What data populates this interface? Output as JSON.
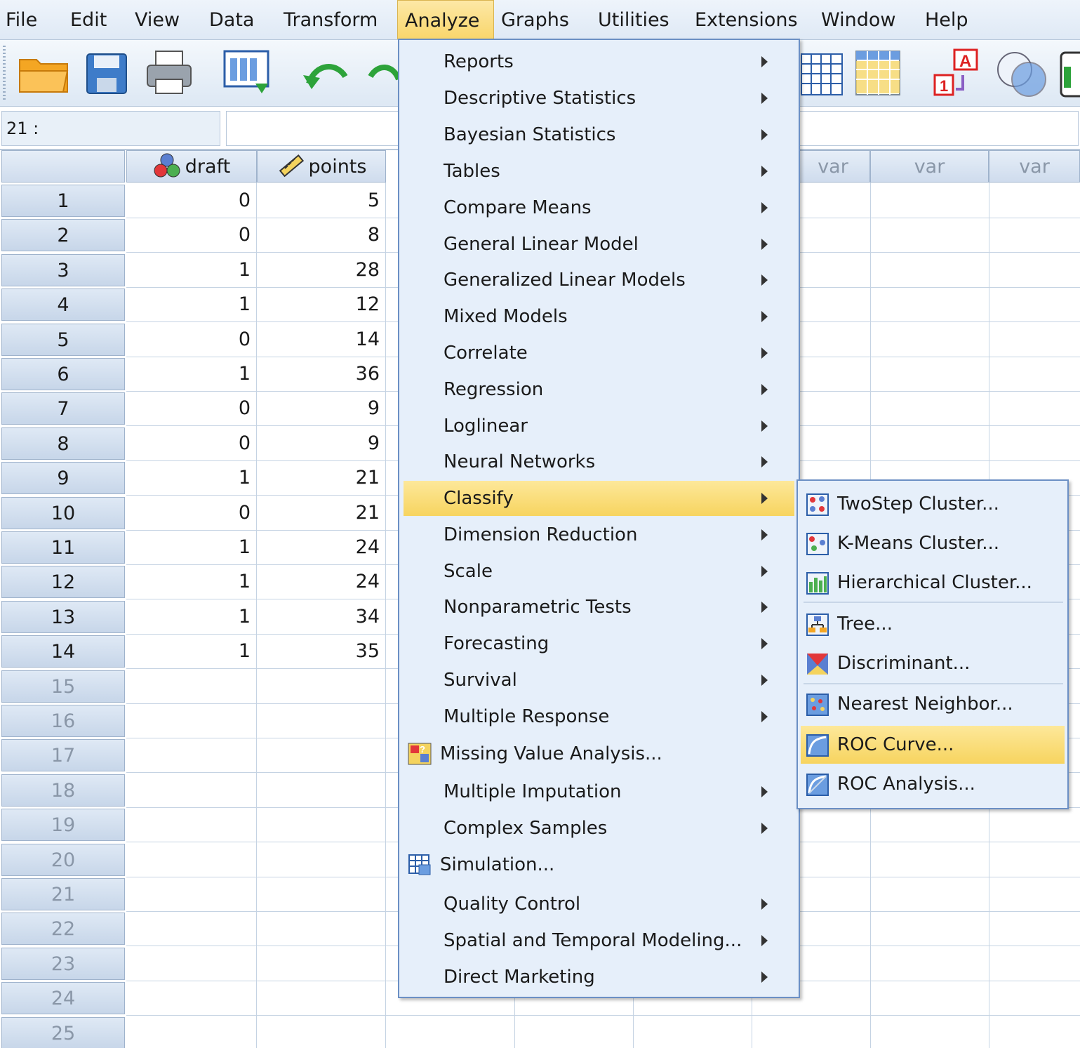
{
  "menubar": [
    "File",
    "Edit",
    "View",
    "Data",
    "Transform",
    "Analyze",
    "Graphs",
    "Utilities",
    "Extensions",
    "Window",
    "Help"
  ],
  "active_menu": "Analyze",
  "toolbar": {
    "icons": [
      "open-folder-icon",
      "save-icon",
      "print-icon",
      "recall-dialog-icon",
      "undo-icon",
      "redo-icon",
      "goto-case-icon",
      "goto-variable-icon",
      "value-labels-icon",
      "use-sets-icon"
    ]
  },
  "cell_editor": {
    "ref": "21 :",
    "value": ""
  },
  "grid": {
    "columns": [
      {
        "name": "draft",
        "type": "nominal"
      },
      {
        "name": "points",
        "type": "scale"
      },
      {
        "name": "var"
      },
      {
        "name": "var"
      },
      {
        "name": "var"
      }
    ],
    "rows": [
      "1",
      "2",
      "3",
      "4",
      "5",
      "6",
      "7",
      "8",
      "9",
      "10",
      "11",
      "12",
      "13",
      "14",
      "15",
      "16",
      "17",
      "18",
      "19",
      "20",
      "21",
      "22",
      "23",
      "24",
      "25"
    ],
    "data": [
      [
        "0",
        "5"
      ],
      [
        "0",
        "8"
      ],
      [
        "1",
        "28"
      ],
      [
        "1",
        "12"
      ],
      [
        "0",
        "14"
      ],
      [
        "1",
        "36"
      ],
      [
        "0",
        "9"
      ],
      [
        "0",
        "9"
      ],
      [
        "1",
        "21"
      ],
      [
        "0",
        "21"
      ],
      [
        "1",
        "24"
      ],
      [
        "1",
        "24"
      ],
      [
        "1",
        "34"
      ],
      [
        "1",
        "35"
      ]
    ]
  },
  "analyze_menu": [
    {
      "label": "Reports",
      "submenu": true
    },
    {
      "label": "Descriptive Statistics",
      "submenu": true
    },
    {
      "label": "Bayesian Statistics",
      "submenu": true
    },
    {
      "label": "Tables",
      "submenu": true
    },
    {
      "label": "Compare Means",
      "submenu": true
    },
    {
      "label": "General Linear Model",
      "submenu": true
    },
    {
      "label": "Generalized Linear Models",
      "submenu": true
    },
    {
      "label": "Mixed Models",
      "submenu": true
    },
    {
      "label": "Correlate",
      "submenu": true
    },
    {
      "label": "Regression",
      "submenu": true
    },
    {
      "label": "Loglinear",
      "submenu": true
    },
    {
      "label": "Neural Networks",
      "submenu": true
    },
    {
      "label": "Classify",
      "submenu": true,
      "highlighted": true
    },
    {
      "label": "Dimension Reduction",
      "submenu": true
    },
    {
      "label": "Scale",
      "submenu": true
    },
    {
      "label": "Nonparametric Tests",
      "submenu": true
    },
    {
      "label": "Forecasting",
      "submenu": true
    },
    {
      "label": "Survival",
      "submenu": true
    },
    {
      "label": "Multiple Response",
      "submenu": true
    },
    {
      "label": "Missing Value Analysis...",
      "submenu": false,
      "icon": "missing-value-icon"
    },
    {
      "label": "Multiple Imputation",
      "submenu": true
    },
    {
      "label": "Complex Samples",
      "submenu": true
    },
    {
      "label": "Simulation...",
      "submenu": false,
      "icon": "simulation-icon"
    },
    {
      "label": "Quality Control",
      "submenu": true
    },
    {
      "label": "Spatial and Temporal Modeling...",
      "submenu": true
    },
    {
      "label": "Direct Marketing",
      "submenu": true
    }
  ],
  "classify_submenu": [
    {
      "label": "TwoStep Cluster...",
      "icon": "twostep-cluster-icon"
    },
    {
      "label": "K-Means Cluster...",
      "icon": "kmeans-cluster-icon"
    },
    {
      "label": "Hierarchical Cluster...",
      "icon": "hierarchical-cluster-icon"
    },
    {
      "label": "Tree...",
      "icon": "tree-icon"
    },
    {
      "label": "Discriminant...",
      "icon": "discriminant-icon"
    },
    {
      "label": "Nearest Neighbor...",
      "icon": "nearest-neighbor-icon"
    },
    {
      "label": "ROC Curve...",
      "icon": "roc-curve-icon",
      "highlighted": true
    },
    {
      "label": "ROC Analysis...",
      "icon": "roc-analysis-icon"
    }
  ],
  "colors": {
    "highlight": "#f9d66c",
    "menu_bg": "#e6effa",
    "menu_border": "#6b8fc4",
    "header_bg": "#cfdced"
  }
}
